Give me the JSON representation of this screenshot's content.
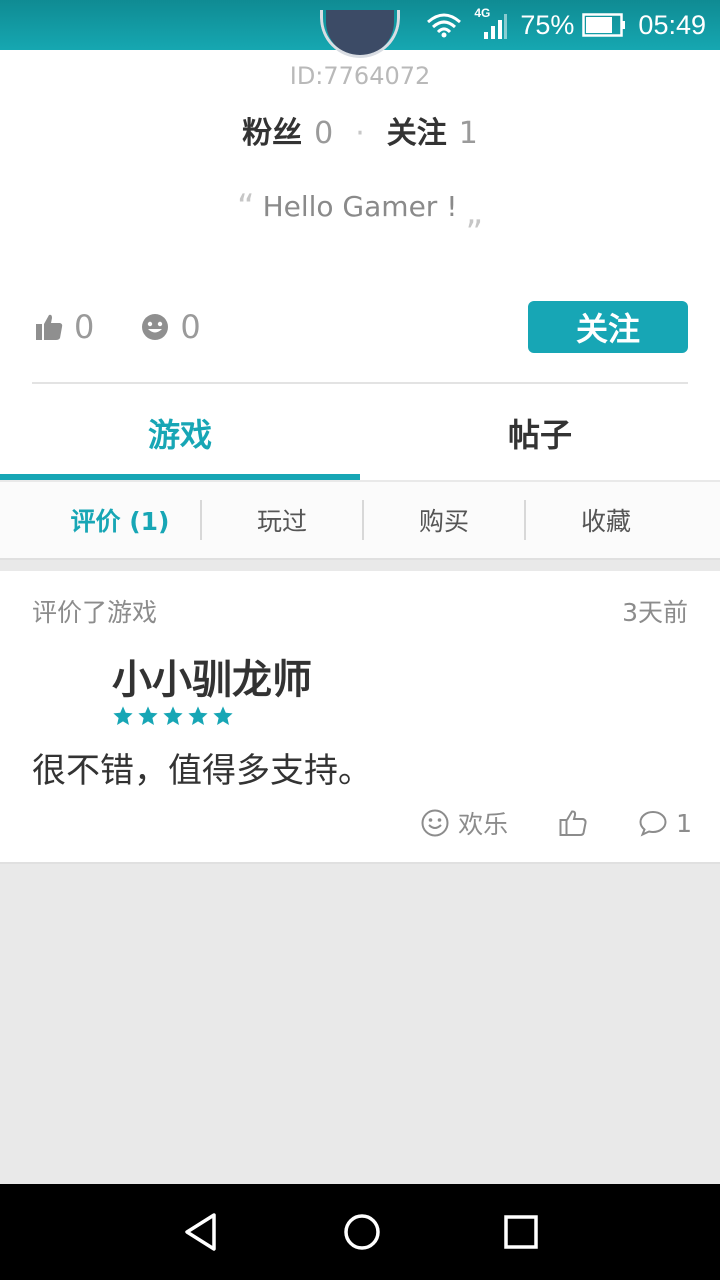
{
  "status_bar": {
    "network": "4G",
    "battery": "75%",
    "time": "05:49"
  },
  "profile": {
    "user_id": "ID:7764072",
    "fans_label": "粉丝",
    "fans_count": "0",
    "following_label": "关注",
    "following_count": "1",
    "motto": "Hello Gamer !",
    "likes_count": "0",
    "fun_count": "0",
    "follow_button": "关注"
  },
  "main_tabs": [
    {
      "label": "游戏",
      "active": true
    },
    {
      "label": "帖子",
      "active": false
    }
  ],
  "sub_tabs": [
    {
      "label": "评价 (1)",
      "active": true
    },
    {
      "label": "玩过"
    },
    {
      "label": "购买"
    },
    {
      "label": "收藏"
    }
  ],
  "review": {
    "action": "评价了游戏",
    "time": "3天前",
    "game_title": "小小驯龙师",
    "rating": 5,
    "comment": "很不错，值得多支持。",
    "reaction_label": "欢乐",
    "comment_count": "1"
  },
  "colors": {
    "accent": "#17a6b5",
    "status_bar": "#16a7b1"
  }
}
